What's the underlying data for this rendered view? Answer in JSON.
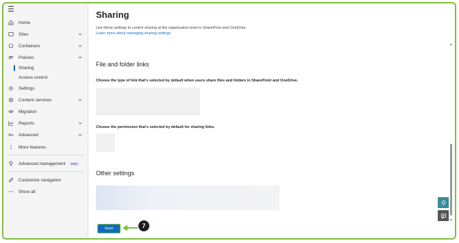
{
  "sidebar": {
    "items": [
      {
        "label": "Home",
        "icon": "home-icon"
      },
      {
        "label": "Sites",
        "icon": "sites-icon"
      },
      {
        "label": "Containers",
        "icon": "containers-icon"
      },
      {
        "label": "Policies",
        "icon": "policies-icon"
      },
      {
        "label": "Settings",
        "icon": "settings-icon"
      },
      {
        "label": "Content services",
        "icon": "content-services-icon"
      },
      {
        "label": "Migration",
        "icon": "migration-icon"
      },
      {
        "label": "Reports",
        "icon": "reports-icon"
      },
      {
        "label": "Advanced",
        "icon": "advanced-icon"
      },
      {
        "label": "More features",
        "icon": "more-features-icon"
      },
      {
        "label": "Advanced management",
        "icon": "diamond-icon",
        "badge": "PRO"
      },
      {
        "label": "Customize navigation",
        "icon": "pencil-icon"
      },
      {
        "label": "Show all",
        "icon": "ellipsis-icon"
      }
    ],
    "sub_items": [
      {
        "label": "Sharing",
        "active": true
      },
      {
        "label": "Access control",
        "active": false
      }
    ]
  },
  "main": {
    "title": "Sharing",
    "description": "Use these settings to control sharing at the organization level in SharePoint and OneDrive.",
    "learn_more": "Learn more about managing sharing settings",
    "file_folder_heading": "File and folder links",
    "link_type_label": "Choose the type of link that's selected by default when users share files and folders in SharePoint and OneDrive.",
    "permission_label": "Choose the permission that's selected by default for sharing links.",
    "other_heading": "Other settings",
    "save_label": "Save",
    "step_number": "7"
  },
  "colors": {
    "accent": "#0f6cbd",
    "highlight": "#7cbf3c"
  }
}
